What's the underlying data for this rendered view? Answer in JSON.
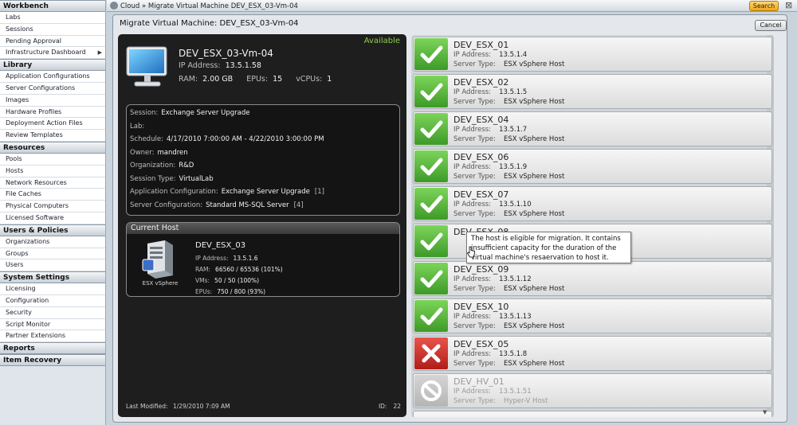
{
  "sidebar": {
    "sections": [
      {
        "title": "Workbench",
        "items": [
          "Labs",
          "Sessions",
          "Pending Approval",
          "Infrastructure Dashboard"
        ]
      },
      {
        "title": "Library",
        "items": [
          "Application Configurations",
          "Server Configurations",
          "Images",
          "Hardware Profiles",
          "Deployment Action Files",
          "Review Templates"
        ]
      },
      {
        "title": "Resources",
        "items": [
          "Pools",
          "Hosts",
          "Network Resources",
          "File Caches",
          "Physical Computers",
          "Licensed Software"
        ]
      },
      {
        "title": "Users & Policies",
        "items": [
          "Organizations",
          "Groups",
          "Users"
        ]
      },
      {
        "title": "System Settings",
        "items": [
          "Licensing",
          "Configuration",
          "Security",
          "Script Monitor",
          "Partner Extensions"
        ]
      },
      {
        "title": "Reports",
        "items": []
      },
      {
        "title": "Item Recovery",
        "items": []
      }
    ]
  },
  "topbar": {
    "breadcrumb": "Cloud  »  Migrate Virtual Machine  DEV_ESX_03-Vm-04",
    "search_label": "Search",
    "close_glyph": "⊠"
  },
  "dialog": {
    "title": "Migrate Virtual Machine: DEV_ESX_03-Vm-04",
    "cancel_label": "Cancel"
  },
  "vm": {
    "status": "Available",
    "name": "DEV_ESX_03-Vm-04",
    "ip_label": "IP Address:",
    "ip": "13.5.1.58",
    "ram_label": "RAM:",
    "ram": "2.00 GB",
    "epus_label": "EPUs:",
    "epus": "15",
    "vcpus_label": "vCPUs:",
    "vcpus": "1"
  },
  "session": {
    "rows": [
      {
        "label": "Session:",
        "value": "Exchange Server Upgrade",
        "extra": ""
      },
      {
        "label": "Lab:",
        "value": "",
        "extra": ""
      },
      {
        "label": "Schedule:",
        "value": "4/17/2010 7:00:00 AM - 4/22/2010 3:00:00 PM",
        "extra": ""
      },
      {
        "label": "Owner:",
        "value": "mandren",
        "extra": ""
      },
      {
        "label": "Organization:",
        "value": "R&D",
        "extra": ""
      },
      {
        "label": "Session Type:",
        "value": "VirtualLab",
        "extra": ""
      },
      {
        "label": "Application Configuration:",
        "value": "Exchange Server Upgrade",
        "extra": "[1]"
      },
      {
        "label": "Server Configuration:",
        "value": "Standard MS-SQL Server",
        "extra": "[4]"
      }
    ]
  },
  "current_host": {
    "header": "Current Host",
    "icon_label": "ESX vSphere",
    "name": "DEV_ESX_03",
    "ip_label": "IP Address:",
    "ip": "13.5.1.6",
    "ram_label": "RAM:",
    "ram": "66560 / 65536 (101%)",
    "vms_label": "VMs:",
    "vms": "50 / 50 (100%)",
    "epus_label": "EPUs:",
    "epus": "750 / 800 (93%)"
  },
  "footer": {
    "modified_label": "Last Modified:",
    "modified": "1/29/2010 7:09 AM",
    "id_label": "ID:",
    "id": "22"
  },
  "hosts": [
    {
      "name": "DEV_ESX_01",
      "ip": "13.5.1.4",
      "type": "ESX vSphere Host",
      "status": "ok"
    },
    {
      "name": "DEV_ESX_02",
      "ip": "13.5.1.5",
      "type": "ESX vSphere Host",
      "status": "ok"
    },
    {
      "name": "DEV_ESX_04",
      "ip": "13.5.1.7",
      "type": "ESX vSphere Host",
      "status": "ok"
    },
    {
      "name": "DEV_ESX_06",
      "ip": "13.5.1.9",
      "type": "ESX vSphere Host",
      "status": "ok"
    },
    {
      "name": "DEV_ESX_07",
      "ip": "13.5.1.10",
      "type": "ESX vSphere Host",
      "status": "ok"
    },
    {
      "name": "DEV_ESX_08",
      "ip": "",
      "type": "",
      "status": "ok"
    },
    {
      "name": "DEV_ESX_09",
      "ip": "13.5.1.12",
      "type": "ESX vSphere Host",
      "status": "ok"
    },
    {
      "name": "DEV_ESX_10",
      "ip": "13.5.1.13",
      "type": "ESX vSphere Host",
      "status": "ok"
    },
    {
      "name": "DEV_ESX_05",
      "ip": "13.5.1.8",
      "type": "ESX vSphere Host",
      "status": "bad"
    },
    {
      "name": "DEV_HV_01",
      "ip": "13.5.1.51",
      "type": "Hyper-V Host",
      "status": "na"
    }
  ],
  "host_labels": {
    "ip": "IP Address:",
    "type": "Server Type:"
  },
  "tooltip": {
    "text": "The host is eligible for migration.  It contains insufficient capacity for the duration of the virtual machine's resaervation to host it."
  },
  "colors": {
    "ok": "#4caf32",
    "bad": "#c8302a",
    "na": "#bcbcbc",
    "available": "#8fcf4c",
    "search": "#f0a81c"
  }
}
